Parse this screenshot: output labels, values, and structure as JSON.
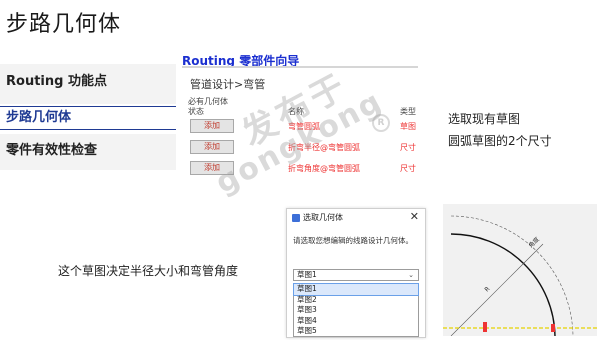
{
  "slide": {
    "title": "步路几何体"
  },
  "nav": {
    "items": [
      {
        "label": "Routing 功能点"
      },
      {
        "label": "步路几何体"
      },
      {
        "label": "零件有效性检查"
      }
    ]
  },
  "wizard": {
    "title": "Routing 零部件向导",
    "breadcrumb": "管道设计>弯管",
    "columns": {
      "required_line1": "必有几何体",
      "required_line2": "状态",
      "name": "名称",
      "type": "类型"
    },
    "add_label": "添加",
    "rows": [
      {
        "name": "弯管圆弧",
        "type": "草图"
      },
      {
        "name": "折弯半径@弯管圆弧",
        "type": "尺寸"
      },
      {
        "name": "折弯角度@弯管圆弧",
        "type": "尺寸"
      }
    ]
  },
  "watermark": {
    "line1": "发布于",
    "line2": "gongkong",
    "reg": "R"
  },
  "notes": {
    "line1": "选取现有草图",
    "line2": "圆弧草图的2个尺寸"
  },
  "caption": "这个草图决定半径大小和弯管角度",
  "dialog": {
    "title": "选取几何体",
    "close": "✕",
    "prompt": "请选取您想编辑的线路设计几何体。",
    "selected": "草图1",
    "options": [
      "草图1",
      "草图2",
      "草图3",
      "草图4",
      "草图5"
    ]
  },
  "sketch": {
    "dim_label_1": "角度",
    "dim_label_2": "R"
  },
  "colors": {
    "accent": "#1b2fd0",
    "nav_active": "#1f3a93",
    "row_text": "#e33333",
    "sketch_arc": "#111111",
    "sketch_axis": "#e6d400"
  }
}
